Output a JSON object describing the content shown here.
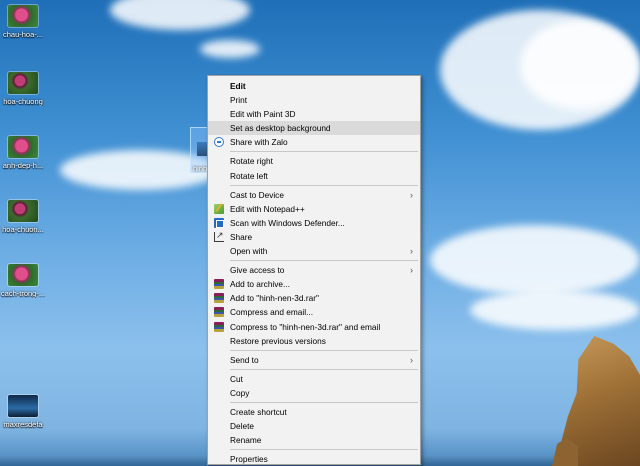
{
  "desktop": {
    "icons": [
      {
        "label": "chau-hoa-..."
      },
      {
        "label": "hoa-chuong"
      },
      {
        "label": "anh-dep-h..."
      },
      {
        "label": "hoa-chuon..."
      },
      {
        "label": "cach-trong-..."
      },
      {
        "label": "maxresdefa"
      }
    ],
    "selected_file_label": "hinh"
  },
  "context_menu": {
    "items": {
      "edit": "Edit",
      "print": "Print",
      "edit_paint3d": "Edit with Paint 3D",
      "set_background": "Set as desktop background",
      "share_zalo": "Share with Zalo",
      "rotate_right": "Rotate right",
      "rotate_left": "Rotate left",
      "cast_device": "Cast to Device",
      "edit_notepadpp": "Edit with Notepad++",
      "scan_defender": "Scan with Windows Defender...",
      "share": "Share",
      "open_with": "Open with",
      "give_access": "Give access to",
      "add_archive": "Add to archive...",
      "add_rar": "Add to \"hinh-nen-3d.rar\"",
      "compress_email": "Compress and email...",
      "compress_rar_email": "Compress to \"hinh-nen-3d.rar\" and email",
      "restore_versions": "Restore previous versions",
      "send_to": "Send to",
      "cut": "Cut",
      "copy": "Copy",
      "create_shortcut": "Create shortcut",
      "delete": "Delete",
      "rename": "Rename",
      "properties": "Properties"
    },
    "submenu_arrow": "›",
    "hover_color": "#dadada"
  },
  "icons": {
    "zalo": "zalo-icon",
    "notepadpp": "notepad-plus-plus-icon",
    "defender": "windows-defender-icon",
    "share": "share-icon",
    "winrar": "winrar-icon"
  }
}
